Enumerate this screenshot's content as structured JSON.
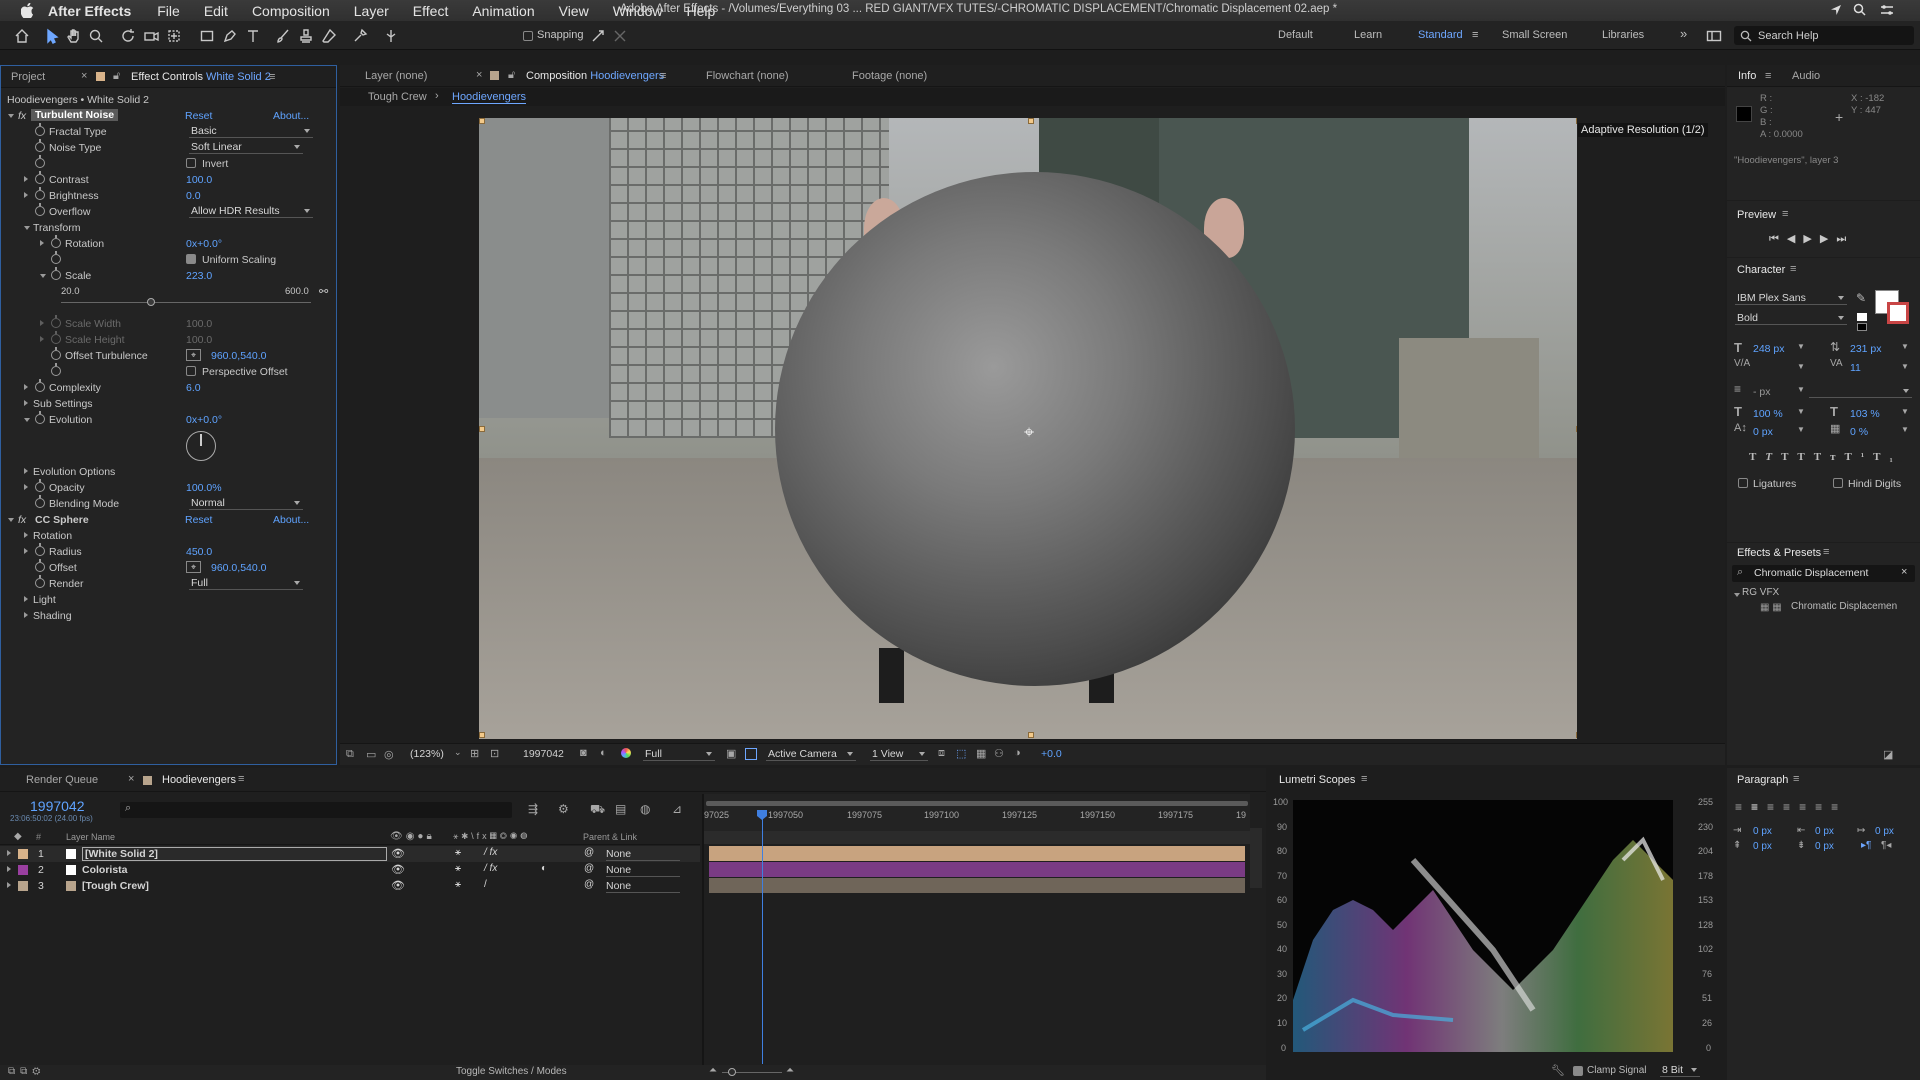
{
  "menubar": {
    "app_name": "After Effects",
    "items": [
      "File",
      "Edit",
      "Composition",
      "Layer",
      "Effect",
      "Animation",
      "View",
      "Window",
      "Help"
    ],
    "doc_title": "Adobe After Effects - /Volumes/Everything 03 ... RED GIANT/VFX TUTES/-CHROMATIC DISPLACEMENT/Chromatic Displacement 02.aep *"
  },
  "toolbar": {
    "snapping_label": "Snapping",
    "workspaces": [
      "Default",
      "Learn",
      "Standard",
      "Small Screen",
      "Libraries"
    ],
    "active_workspace": "Standard",
    "search_placeholder": "Search Help"
  },
  "effect_controls": {
    "tab_project": "Project",
    "tab_effect_prefix": "Effect Controls",
    "tab_effect_layer": "White Solid 2",
    "subtitle": "Hoodievengers • White Solid 2",
    "effect1_name": "Turbulent Noise",
    "reset": "Reset",
    "about": "About...",
    "rows": {
      "fractal_type": {
        "label": "Fractal Type",
        "value": "Basic"
      },
      "noise_type": {
        "label": "Noise Type",
        "value": "Soft Linear"
      },
      "invert": {
        "label": "Invert"
      },
      "contrast": {
        "label": "Contrast",
        "value": "100.0"
      },
      "brightness": {
        "label": "Brightness",
        "value": "0.0"
      },
      "overflow": {
        "label": "Overflow",
        "value": "Allow HDR Results"
      },
      "transform": {
        "label": "Transform"
      },
      "rotation": {
        "label": "Rotation",
        "value": "0x+0.0°"
      },
      "uniform_scaling": {
        "label": "Uniform Scaling"
      },
      "scale": {
        "label": "Scale",
        "value": "223.0",
        "min": "20.0",
        "max": "600.0"
      },
      "scale_width": {
        "label": "Scale Width",
        "value": "100.0"
      },
      "scale_height": {
        "label": "Scale Height",
        "value": "100.0"
      },
      "offset_turbulence": {
        "label": "Offset Turbulence",
        "value": "960.0,540.0"
      },
      "perspective_offset": {
        "label": "Perspective Offset"
      },
      "complexity": {
        "label": "Complexity",
        "value": "6.0"
      },
      "sub_settings": {
        "label": "Sub Settings"
      },
      "evolution": {
        "label": "Evolution",
        "value": "0x+0.0°"
      },
      "evolution_options": {
        "label": "Evolution Options"
      },
      "opacity": {
        "label": "Opacity",
        "value": "100.0%"
      },
      "blending_mode": {
        "label": "Blending Mode",
        "value": "Normal"
      }
    },
    "effect2_name": "CC Sphere",
    "rows2": {
      "rotation": {
        "label": "Rotation"
      },
      "radius": {
        "label": "Radius",
        "value": "450.0"
      },
      "offset": {
        "label": "Offset",
        "value": "960.0,540.0"
      },
      "render": {
        "label": "Render",
        "value": "Full"
      },
      "light": {
        "label": "Light"
      },
      "shading": {
        "label": "Shading"
      }
    }
  },
  "viewer": {
    "tab_layer": "Layer (none)",
    "tab_comp_prefix": "Composition",
    "tab_comp_name": "Hoodievengers",
    "tab_flowchart": "Flowchart (none)",
    "tab_footage": "Footage (none)",
    "breadcrumb_parent": "Tough Crew",
    "breadcrumb_current": "Hoodievengers",
    "adaptive": "Adaptive Resolution (1/2)",
    "zoom": "(123%)",
    "timecode": "1997042",
    "resolution": "Full",
    "camera": "Active Camera",
    "views": "1 View",
    "exposure": "+0.0"
  },
  "info": {
    "tab_info": "Info",
    "tab_audio": "Audio",
    "r": "R :",
    "g": "G :",
    "b": "B :",
    "a": "A :  0.0000",
    "x": "X : -182",
    "y": "Y : 447",
    "layer": "\"Hoodievengers\", layer 3"
  },
  "preview": {
    "title": "Preview"
  },
  "character": {
    "title": "Character",
    "font": "IBM Plex Sans",
    "style": "Bold",
    "size": "248 px",
    "leading": "231 px",
    "tracking": "11",
    "stroke": "- px",
    "vscale": "100 %",
    "hscale": "103 %",
    "baseline": "0 px",
    "tsume": "0 %",
    "ligatures": "Ligatures",
    "hindi": "Hindi Digits"
  },
  "effects_presets": {
    "title": "Effects & Presets",
    "search": "Chromatic Displacement",
    "folder": "RG VFX",
    "item": "Chromatic Displacemen"
  },
  "timeline": {
    "tab_render": "Render Queue",
    "tab_comp": "Hoodievengers",
    "timecode": "1997042",
    "timecode_sub": "23:06:50:02 (24.00 fps)",
    "col_name": "Layer Name",
    "col_parent": "Parent & Link",
    "ruler": [
      "97025",
      "1997050",
      "1997075",
      "1997100",
      "1997125",
      "1997150",
      "1997175",
      "19"
    ],
    "layers": [
      {
        "num": "1",
        "name": "[White Solid 2]",
        "parent": "None",
        "label_color": "#d8b38a",
        "bar_color": "#c8a37f"
      },
      {
        "num": "2",
        "name": "Colorista",
        "parent": "None",
        "label_color": "#9a3fa0",
        "bar_color": "#7a3b84"
      },
      {
        "num": "3",
        "name": "[Tough Crew]",
        "parent": "None",
        "label_color": "#b8a48c",
        "bar_color": "#6f6559"
      }
    ],
    "toggle": "Toggle Switches / Modes"
  },
  "lumetri": {
    "title": "Lumetri Scopes",
    "left_scale": [
      "100",
      "90",
      "80",
      "70",
      "60",
      "50",
      "40",
      "30",
      "20",
      "10",
      "0"
    ],
    "right_scale": [
      "255",
      "230",
      "204",
      "178",
      "153",
      "128",
      "102",
      "76",
      "51",
      "26",
      "0"
    ],
    "clamp": "Clamp Signal",
    "bits": "8 Bit"
  },
  "paragraph": {
    "title": "Paragraph",
    "indent_left": "0 px",
    "indent_right": "0 px",
    "indent_first": "0 px",
    "space_before": "0 px",
    "space_after": "0 px",
    "space_x": "0 px"
  }
}
